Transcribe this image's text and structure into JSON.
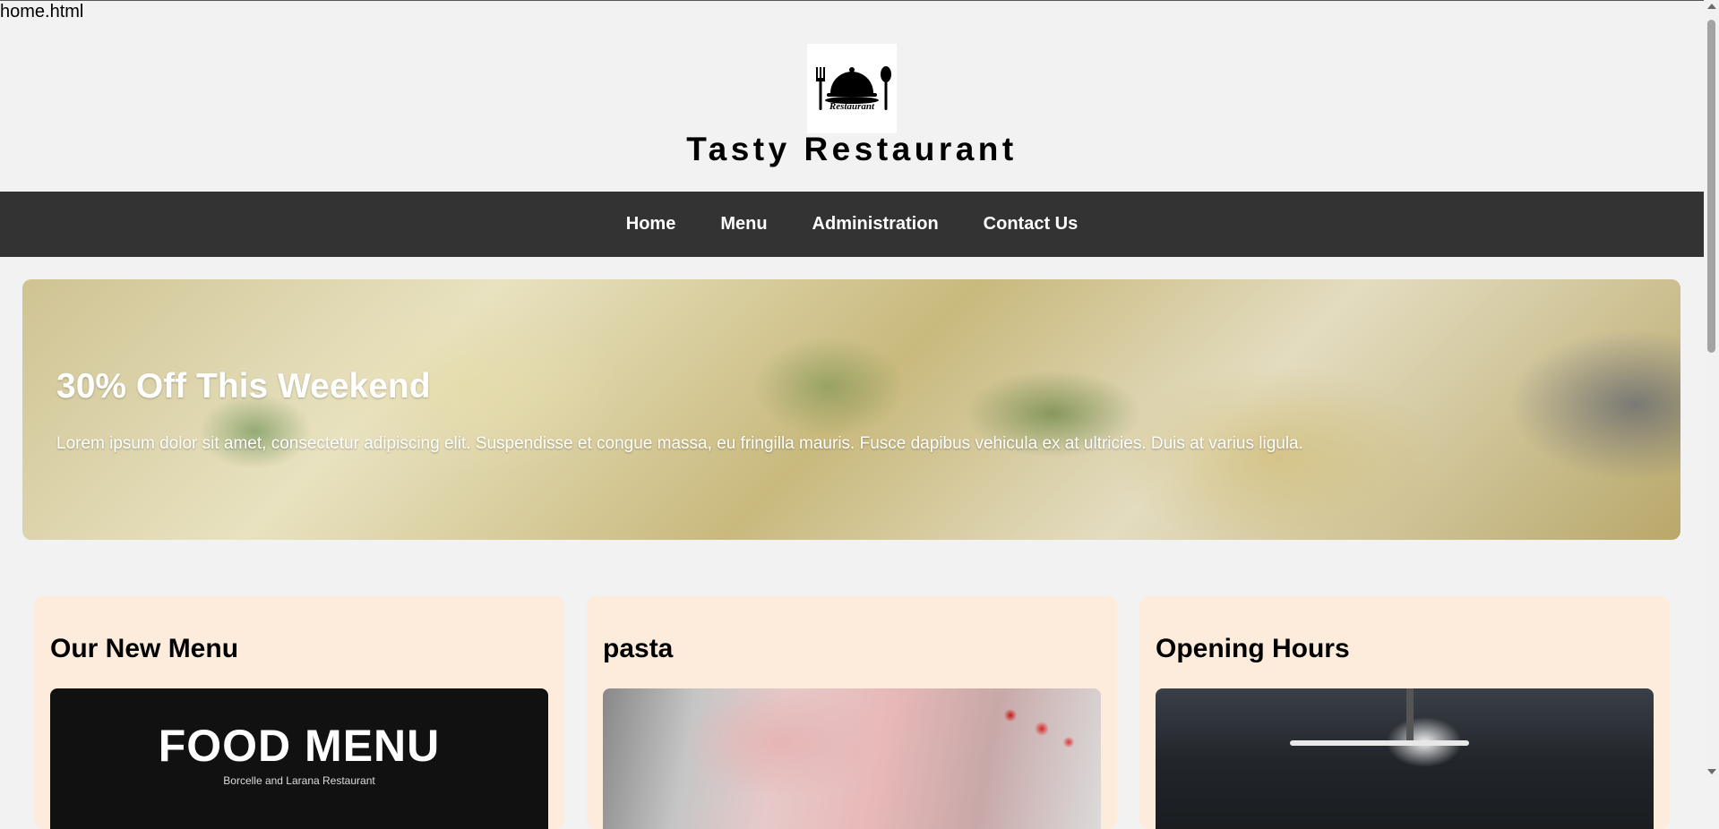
{
  "file_label": "home.html",
  "header": {
    "logo_text": "Restaurant",
    "site_title": "Tasty Restaurant"
  },
  "nav": {
    "items": [
      {
        "label": "Home"
      },
      {
        "label": "Menu"
      },
      {
        "label": "Administration"
      },
      {
        "label": "Contact Us"
      }
    ]
  },
  "hero": {
    "title": "30% Off This Weekend",
    "text": "Lorem ipsum dolor sit amet, consectetur adipiscing elit. Suspendisse et congue massa, eu fringilla mauris. Fusce dapibus vehicula ex at ultricies. Duis at varius ligula."
  },
  "cards": [
    {
      "title": "Our New Menu",
      "image_heading": "FOOD MENU",
      "image_subtext": "Borcelle and Larana Restaurant"
    },
    {
      "title": "pasta"
    },
    {
      "title": "Opening Hours"
    }
  ],
  "colors": {
    "page_background": "#f2f2f2",
    "navbar": "#333333",
    "card_background": "#fdebdc"
  }
}
